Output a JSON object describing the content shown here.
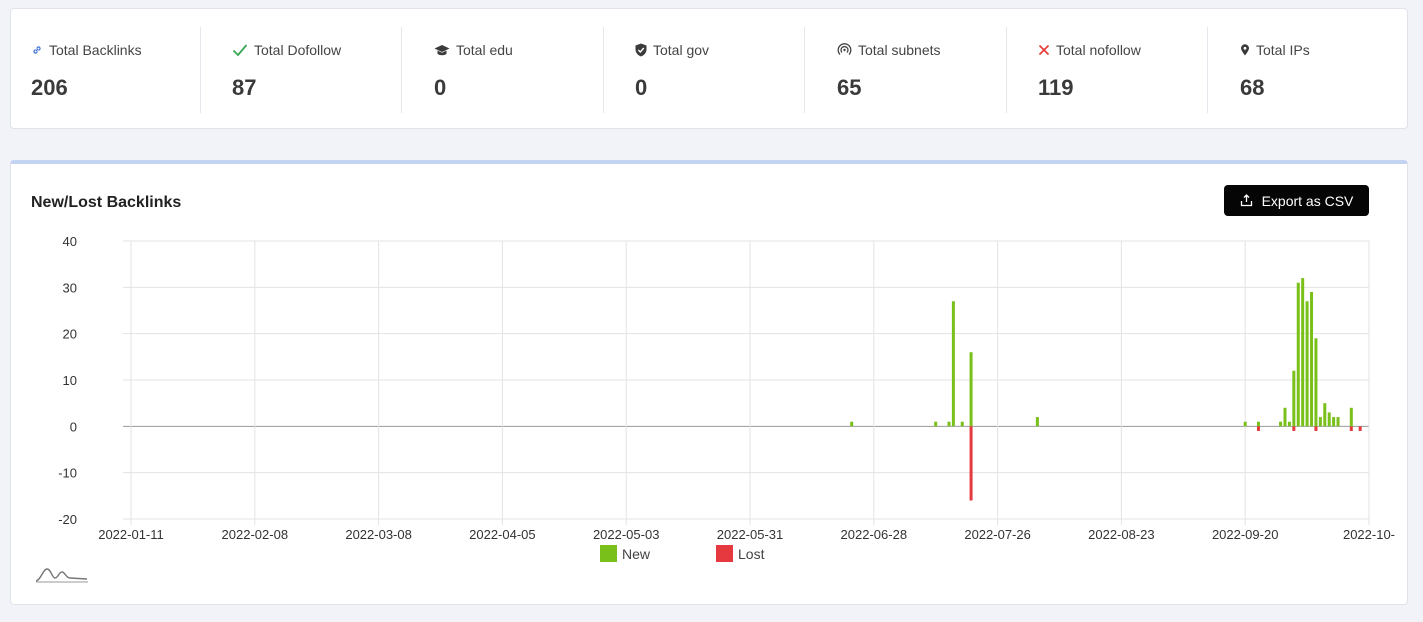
{
  "stats": [
    {
      "label": "Total Backlinks",
      "value": "206",
      "icon": "link-icon"
    },
    {
      "label": "Total Dofollow",
      "value": "87",
      "icon": "check-icon"
    },
    {
      "label": "Total edu",
      "value": "0",
      "icon": "graduation-cap-icon"
    },
    {
      "label": "Total gov",
      "value": "0",
      "icon": "shield-check-icon"
    },
    {
      "label": "Total subnets",
      "value": "65",
      "icon": "signal-icon"
    },
    {
      "label": "Total nofollow",
      "value": "119",
      "icon": "x-mark-icon"
    },
    {
      "label": "Total IPs",
      "value": "68",
      "icon": "location-pin-icon"
    }
  ],
  "colors": {
    "new": "#7ac01b",
    "lost": "#e5393f",
    "link": "#3b6fd6",
    "check": "#3aa757",
    "x": "#e53935",
    "accent_bar": "#c4d3f2"
  },
  "chart_section": {
    "title": "New/Lost Backlinks",
    "export_label": "Export as CSV"
  },
  "chart_data": {
    "type": "bar",
    "title": "New/Lost Backlinks",
    "xlabel": "",
    "ylabel": "",
    "ylim": [
      -20,
      40
    ],
    "yticks": [
      40,
      30,
      20,
      10,
      0,
      -10,
      -20
    ],
    "xlim": [
      "2022-01-11",
      "2022-10-04"
    ],
    "xtick_labels": [
      "2022-01-11",
      "2022-02-08",
      "2022-03-08",
      "2022-04-05",
      "2022-05-03",
      "2022-05-31",
      "2022-06-28",
      "2022-07-26",
      "2022-08-23",
      "2022-09-20",
      "2022-10-"
    ],
    "grid": true,
    "legend_position": "bottom-center",
    "series": [
      {
        "name": "New",
        "color": "#7ac01b",
        "points": [
          {
            "x": "2022-06-23",
            "y": 1
          },
          {
            "x": "2022-07-12",
            "y": 1
          },
          {
            "x": "2022-07-15",
            "y": 1
          },
          {
            "x": "2022-07-16",
            "y": 27
          },
          {
            "x": "2022-07-18",
            "y": 1
          },
          {
            "x": "2022-07-20",
            "y": 16
          },
          {
            "x": "2022-08-04",
            "y": 2
          },
          {
            "x": "2022-09-20",
            "y": 1
          },
          {
            "x": "2022-09-23",
            "y": 1
          },
          {
            "x": "2022-09-28",
            "y": 1
          },
          {
            "x": "2022-09-29",
            "y": 4
          },
          {
            "x": "2022-09-30",
            "y": 1
          },
          {
            "x": "2022-10-01",
            "y": 12
          },
          {
            "x": "2022-10-02",
            "y": 31
          },
          {
            "x": "2022-10-03",
            "y": 32
          },
          {
            "x": "2022-10-04",
            "y": 27
          },
          {
            "x": "2022-10-05",
            "y": 29
          },
          {
            "x": "2022-10-06",
            "y": 19
          },
          {
            "x": "2022-10-07",
            "y": 2
          },
          {
            "x": "2022-10-08",
            "y": 5
          },
          {
            "x": "2022-10-09",
            "y": 3
          },
          {
            "x": "2022-10-10",
            "y": 2
          },
          {
            "x": "2022-10-11",
            "y": 2
          },
          {
            "x": "2022-10-14",
            "y": 4
          }
        ]
      },
      {
        "name": "Lost",
        "color": "#e5393f",
        "points": [
          {
            "x": "2022-07-20",
            "y": -16
          },
          {
            "x": "2022-09-23",
            "y": -1
          },
          {
            "x": "2022-10-01",
            "y": -1
          },
          {
            "x": "2022-10-06",
            "y": -1
          },
          {
            "x": "2022-10-14",
            "y": -1
          },
          {
            "x": "2022-10-16",
            "y": -1
          }
        ]
      }
    ]
  }
}
